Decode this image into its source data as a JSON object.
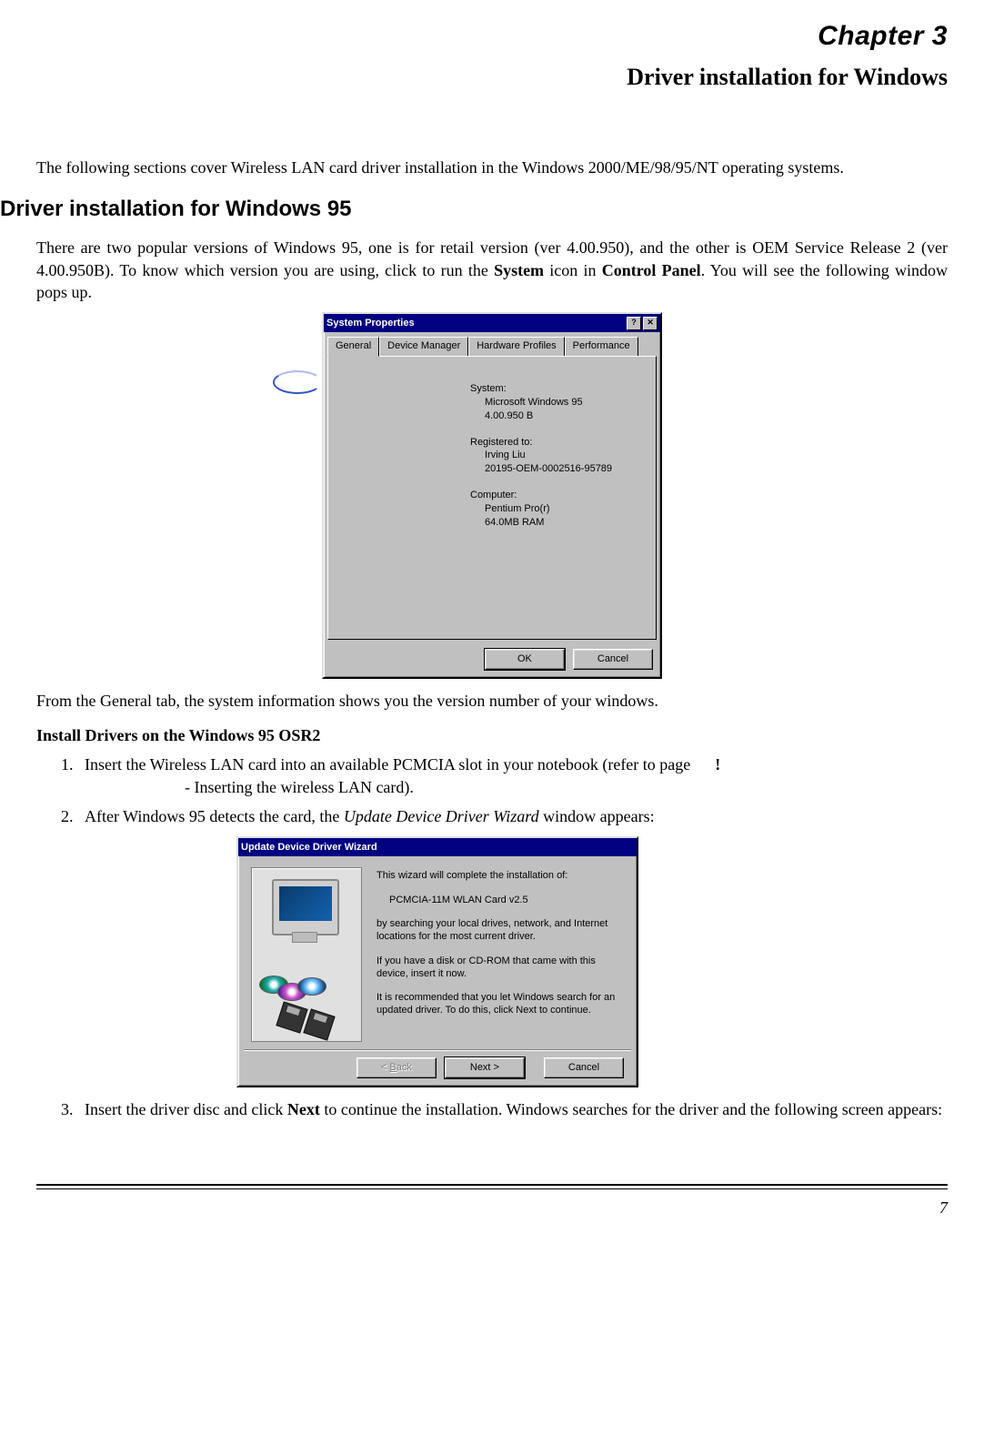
{
  "chapter": "Chapter 3",
  "subtitle": "Driver installation for Windows",
  "intro": "The following sections cover Wireless LAN card driver installation in the Windows 2000/ME/98/95/NT operating systems.",
  "section_heading": "Driver installation for Windows 95",
  "para1_pre": "There are two popular versions of Windows 95, one is for retail version (ver 4.00.950), and the other is OEM Service Release 2 (ver 4.00.950B). To know which version you are using, click to run the ",
  "para1_b1": "System",
  "para1_mid": " icon in ",
  "para1_b2": "Control Panel",
  "para1_post": ". You will see the following window pops up.",
  "dlg1": {
    "title": "System Properties",
    "help": "?",
    "close": "✕",
    "tabs": [
      "General",
      "Device Manager",
      "Hardware Profiles",
      "Performance"
    ],
    "labels": {
      "system": "System:",
      "system_v1": "Microsoft Windows 95",
      "system_v2": "4.00.950 B",
      "reg": "Registered to:",
      "reg_v1": "Irving Liu",
      "reg_v2": "20195-OEM-0002516-95789",
      "comp": "Computer:",
      "comp_v1": "Pentium Pro(r)",
      "comp_v2": "64.0MB RAM"
    },
    "ok": "OK",
    "cancel": "Cancel"
  },
  "para2": "From the General tab, the system information shows you the version number of your windows.",
  "subheading": "Install Drivers on the Windows 95 OSR2",
  "step1_a": "Insert the  Wireless LAN card into an available PCMCIA slot in your notebook (refer to page ",
  "step1_bang": "!",
  "step1_b": " - Inserting the wireless LAN card).",
  "step2_a": "After Windows 95 detects the card, the ",
  "step2_i": "Update Device Driver Wizard",
  "step2_b": " window appears:",
  "dlg2": {
    "title": "Update Device Driver Wizard",
    "line1": "This wizard will complete the installation of:",
    "line2": "PCMCIA-11M WLAN Card v2.5",
    "line3": "by searching your local drives, network, and Internet locations for the most current driver.",
    "line4": "If you have a disk or CD-ROM that came with this device, insert it now.",
    "line5": "It is recommended that you let Windows search for an updated driver. To do this, click Next to continue.",
    "back": "< Back",
    "next": "Next >",
    "cancel": "Cancel"
  },
  "step3_a": "Insert the driver disc and click ",
  "step3_b": "Next",
  "step3_c": " to continue the installation. Windows searches for the driver and the following screen appears:",
  "page_number": "7"
}
